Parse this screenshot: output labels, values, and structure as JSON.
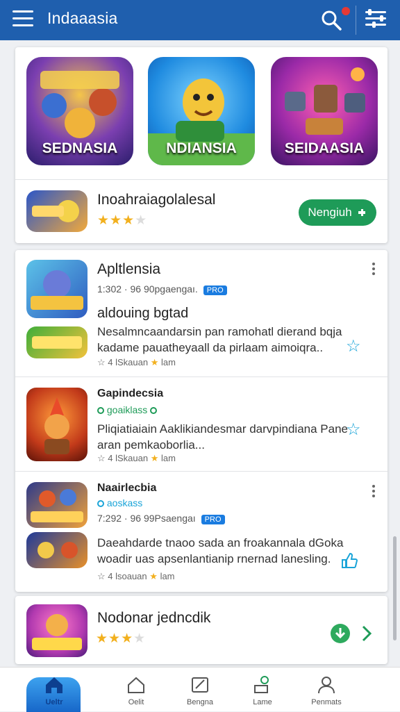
{
  "appbar": {
    "title": "Indaaasia",
    "hamburger_icon": "hamburger-menu-icon",
    "search_icon": "search-icon",
    "filter_icon": "filter-icon",
    "colors": {
      "bar": "#1f5fae"
    }
  },
  "featured": {
    "apps": [
      {
        "label": "SEDNASIA",
        "icon": "game-icon-heroes"
      },
      {
        "label": "NDIANSIA",
        "icon": "game-icon-mascot"
      },
      {
        "label": "SEIDAASIA",
        "icon": "game-icon-battle"
      }
    ],
    "promo": {
      "name": "Inoahraiagolalesal",
      "rating": 3,
      "install_label": "Nengiuh"
    }
  },
  "list": [
    {
      "name": "Apltlensia",
      "meta": "1:302 · 96 90pgaengaı.",
      "badge": "PRO",
      "subtitle": "aldouing bgtad",
      "description": "Nesalmncaandarsin pan ramohatl dierand bqja kadame pauatheyaall da pirlaam aimoiqra..",
      "footer_left": "☆ 4 lSkauan",
      "footer_right": "lam"
    },
    {
      "name": "Gapindecsia",
      "tag": "goaiklass",
      "description": "Pliqiatiaiain Aaklikiandesmar darvpindiana Pane aran pemkaoborlia...",
      "footer_left": "☆ 4 lSkauan",
      "footer_right": "lam"
    },
    {
      "name": "Naairlecbia",
      "tag": "aoskass",
      "meta": "7:292 · 96 99Psaengaı",
      "badge": "PRO",
      "description": "Daeahdarde tnaoo sada an froakannala dGoka woadir uas apsenlantianip rnernad lanesling.",
      "footer_left": "☆ 4 lsoauan",
      "footer_right": "lam"
    },
    {
      "name": "Nodonar jedncdik",
      "rating": 3
    }
  ],
  "bottom_nav": [
    {
      "label": "Ueltr",
      "icon": "home-icon"
    },
    {
      "label": "Oelit",
      "icon": "house-outline-icon"
    },
    {
      "label": "Bengna",
      "icon": "edit-note-icon"
    },
    {
      "label": "Lame",
      "icon": "download-icon"
    },
    {
      "label": "Penmats",
      "icon": "profile-icon"
    }
  ]
}
